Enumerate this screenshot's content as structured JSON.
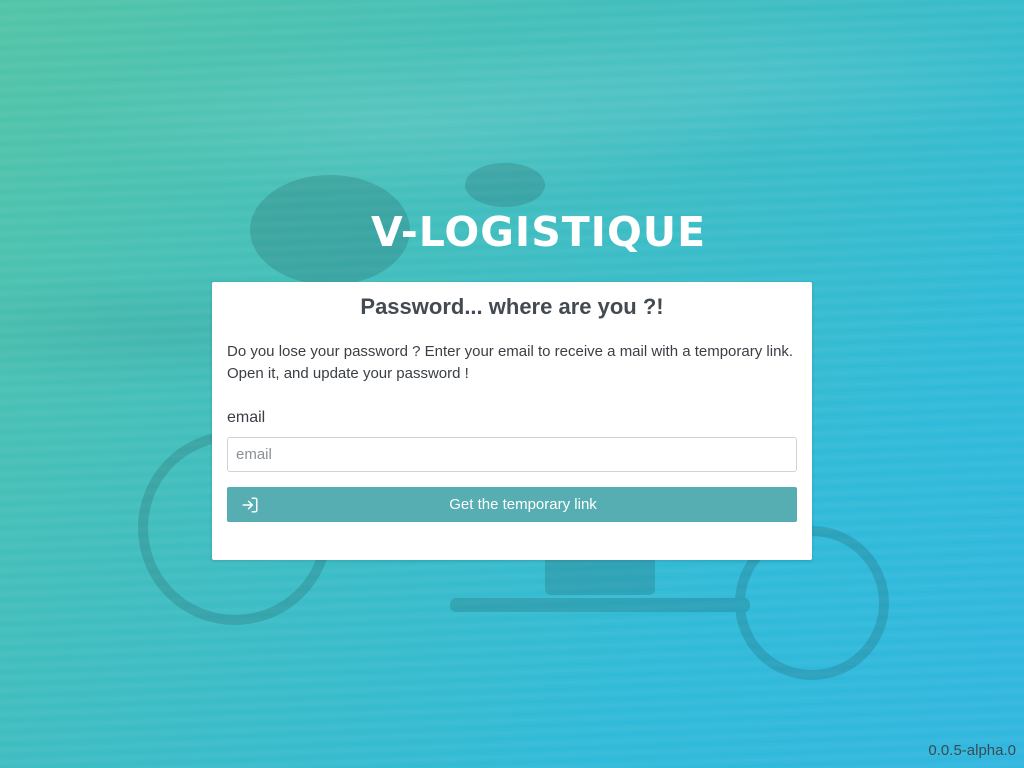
{
  "logo": {
    "text": "V-LOGISTIQUE"
  },
  "card": {
    "title": "Password... where are you ?!",
    "description": "Do you lose your password ? Enter your email to receive a mail with a temporary link. Open it, and update your password !",
    "email_label": "email",
    "email_placeholder": "email",
    "email_value": "",
    "submit_label": "Get the temporary link",
    "submit_icon": "login-arrow-icon"
  },
  "footer": {
    "version": "0.0.5-alpha.0"
  },
  "colors": {
    "button": "#56aeb2",
    "background_start": "#52c4a6",
    "background_end": "#31b6df"
  }
}
